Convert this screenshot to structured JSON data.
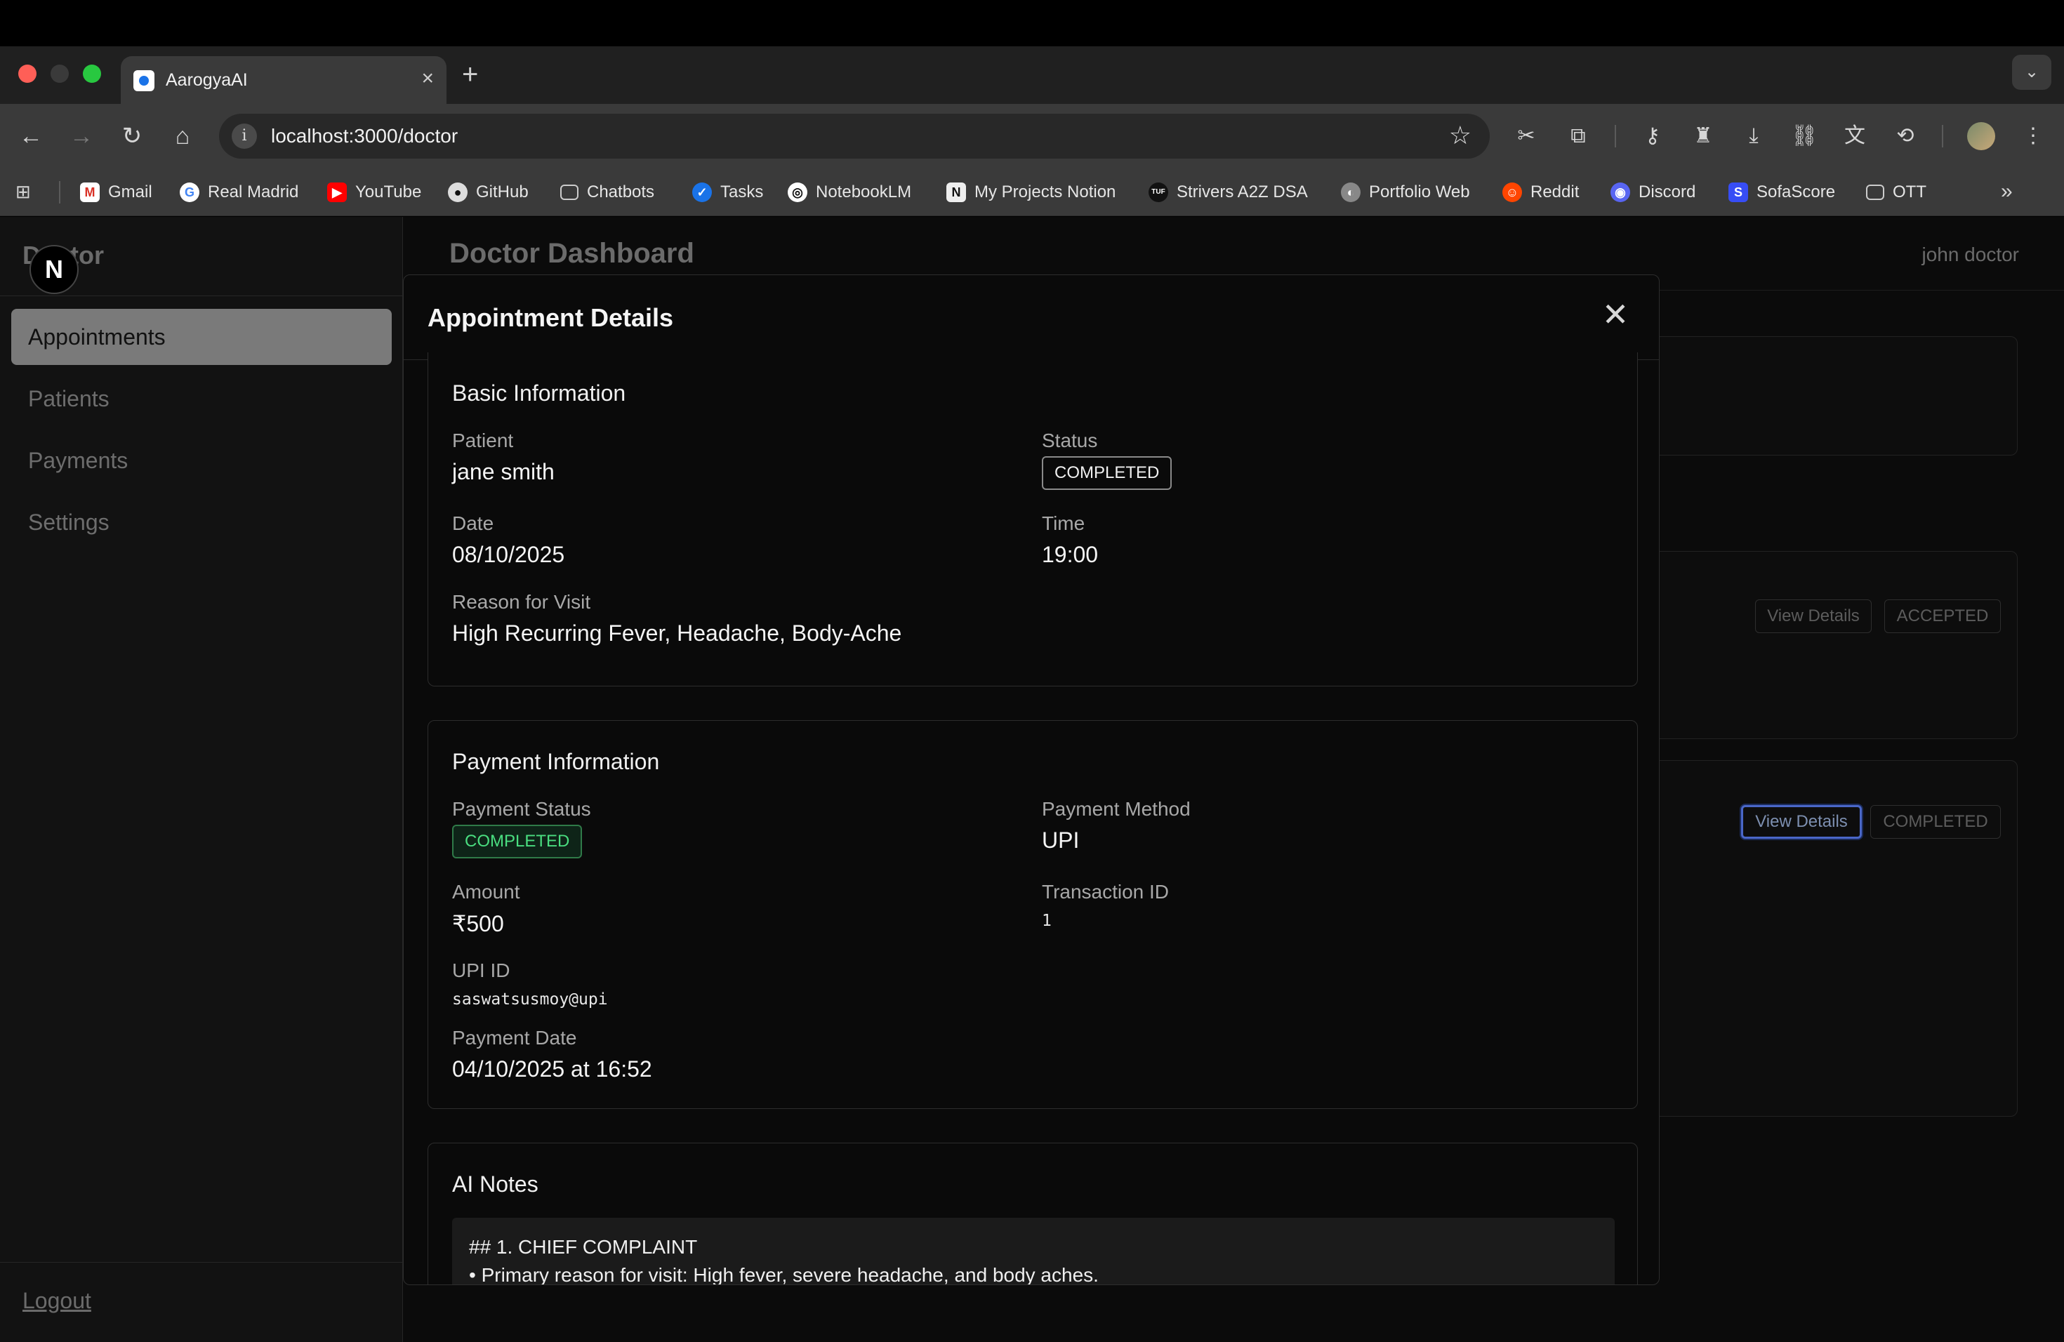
{
  "browser": {
    "tab_title": "AarogyaAI",
    "tab_close": "×",
    "new_tab": "+",
    "url": "localhost:3000/doctor",
    "bookmarks": [
      "Gmail",
      "Real Madrid",
      "YouTube",
      "GitHub",
      "Chatbots",
      "Tasks",
      "NotebookLM",
      "My Projects Notion",
      "Strivers A2Z DSA",
      "Portfolio Web",
      "Reddit",
      "Discord",
      "SofaScore",
      "OTT"
    ],
    "more_bookmarks": "»"
  },
  "sidebar": {
    "title": "Doctor",
    "logo_letter": "N",
    "items": [
      "Appointments",
      "Patients",
      "Payments",
      "Settings"
    ],
    "logout": "Logout"
  },
  "header": {
    "title": "Doctor Dashboard",
    "user": "john doctor"
  },
  "background_cards": {
    "row1": {
      "view_label": "View Details",
      "status": "ACCEPTED"
    },
    "row2": {
      "view_label": "View Details",
      "status": "COMPLETED"
    }
  },
  "modal": {
    "title": "Appointment Details",
    "close": "✕",
    "basic": {
      "title": "Basic Information",
      "patient_label": "Patient",
      "patient": "jane smith",
      "status_label": "Status",
      "status": "COMPLETED",
      "date_label": "Date",
      "date": "08/10/2025",
      "time_label": "Time",
      "time": "19:00",
      "reason_label": "Reason for Visit",
      "reason": "High Recurring Fever, Headache, Body-Ache"
    },
    "payment": {
      "title": "Payment Information",
      "status_label": "Payment Status",
      "status": "COMPLETED",
      "method_label": "Payment Method",
      "method": "UPI",
      "amount_label": "Amount",
      "amount": "₹500",
      "txn_label": "Transaction ID",
      "txn": "1",
      "upi_label": "UPI ID",
      "upi": "saswatsusmoy@upi",
      "date_label": "Payment Date",
      "date": "04/10/2025 at 16:52"
    },
    "notes": {
      "title": "AI Notes",
      "lines": [
        "## 1. CHIEF COMPLAINT",
        "• Primary reason for visit: High fever, severe headache, and body aches."
      ]
    }
  }
}
